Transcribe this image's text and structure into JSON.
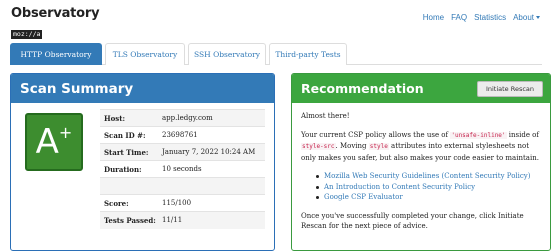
{
  "brand": {
    "title": "Observatory",
    "subtitle": "moz://a"
  },
  "topnav": {
    "home": "Home",
    "faq": "FAQ",
    "statistics": "Statistics",
    "about": "About"
  },
  "tabs": [
    {
      "label": "HTTP Observatory",
      "active": true
    },
    {
      "label": "TLS Observatory",
      "active": false
    },
    {
      "label": "SSH Observatory",
      "active": false
    },
    {
      "label": "Third-party Tests",
      "active": false
    }
  ],
  "scan_summary": {
    "heading": "Scan Summary",
    "grade": "A",
    "grade_modifier": "+",
    "rows": [
      {
        "label": "Host:",
        "value": "app.ledgy.com"
      },
      {
        "label": "Scan ID #:",
        "value": "23698761"
      },
      {
        "label": "Start Time:",
        "value": "January 7, 2022 10:24 AM"
      },
      {
        "label": "Duration:",
        "value": "10 seconds"
      },
      {
        "label": "",
        "value": ""
      },
      {
        "label": "Score:",
        "value": "115/100"
      },
      {
        "label": "Tests Passed:",
        "value": "11/11"
      }
    ]
  },
  "recommendation": {
    "heading": "Recommendation",
    "button": "Initiate Rescan",
    "intro": "Almost there!",
    "p1_a": "Your current CSP policy allows the use of ",
    "p1_code1": "'unsafe-inline'",
    "p1_b": " inside of ",
    "p1_code2": "style-src",
    "p1_c": ". Moving ",
    "p1_code3": "style",
    "p1_d": " attributes into external stylesheets not only makes you safer, but also makes your code easier to maintain.",
    "links": [
      "Mozilla Web Security Guidelines (Content Security Policy)",
      "An Introduction to Content Security Policy",
      "Google CSP Evaluator"
    ],
    "p2": "Once you've successfully completed your change, click Initiate Rescan for the next piece of advice."
  }
}
